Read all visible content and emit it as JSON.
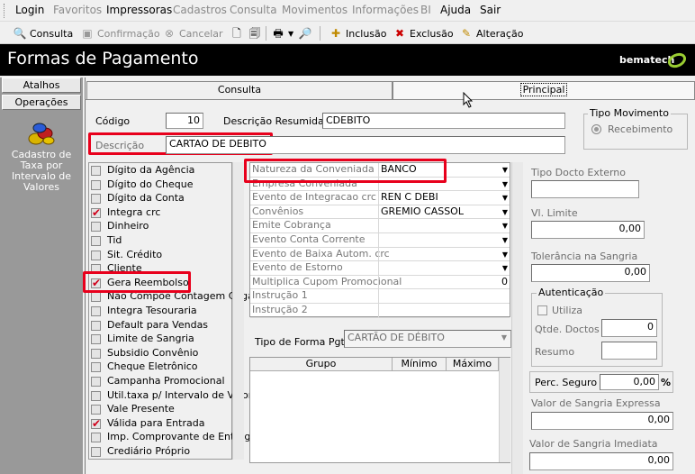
{
  "menu": {
    "items": [
      {
        "label": "Login",
        "enabled": true
      },
      {
        "label": "Favoritos",
        "enabled": false
      },
      {
        "label": "Impressoras",
        "enabled": true
      },
      {
        "label": "Cadastros",
        "enabled": false
      },
      {
        "label": "Consulta",
        "enabled": false
      },
      {
        "label": "Movimentos",
        "enabled": false
      },
      {
        "label": "Informações",
        "enabled": false
      },
      {
        "label": "BI",
        "enabled": false
      },
      {
        "label": "Ajuda",
        "enabled": true
      },
      {
        "label": "Sair",
        "enabled": true
      }
    ]
  },
  "toolbar": {
    "consulta": "Consulta",
    "confirmacao": "Confirmação",
    "cancelar": "Cancelar",
    "inclusao": "Inclusão",
    "exclusao": "Exclusão",
    "alteracao": "Alteração"
  },
  "window": {
    "title": "Formas de Pagamento",
    "brand": "bematech"
  },
  "sidebar": {
    "atalhos": "Atalhos",
    "operacoes": "Operações",
    "item_label": "Cadastro de Taxa por Intervalo de Valores"
  },
  "tabs": {
    "consulta": "Consulta",
    "principal": "Principal"
  },
  "form": {
    "codigo_label": "Código",
    "codigo_value": "10",
    "desc_resumida_label": "Descrição Resumida",
    "desc_resumida_value": "CDEBITO",
    "descricao_label": "Descrição",
    "descricao_value": "CARTAO DE DEBITO",
    "tipo_movimento_label": "Tipo Movimento",
    "recebimento_label": "Recebimento"
  },
  "checklist": [
    {
      "label": "Dígito da Agência",
      "checked": false
    },
    {
      "label": "Dígito do Cheque",
      "checked": false
    },
    {
      "label": "Dígito da Conta",
      "checked": false
    },
    {
      "label": "Integra crc",
      "checked": true
    },
    {
      "label": "Dinheiro",
      "checked": false
    },
    {
      "label": "Tid",
      "checked": false
    },
    {
      "label": "Sit. Crédito",
      "checked": false
    },
    {
      "label": "Cliente",
      "checked": false
    },
    {
      "label": "Gera Reembolso",
      "checked": true
    },
    {
      "label": "Não Compõe Contagem Cega",
      "checked": false
    },
    {
      "label": "Integra Tesouraria",
      "checked": false
    },
    {
      "label": "Default para Vendas",
      "checked": false
    },
    {
      "label": "Limite de Sangria",
      "checked": false
    },
    {
      "label": "Subsidio Convênio",
      "checked": false
    },
    {
      "label": "Cheque Eletrônico",
      "checked": false
    },
    {
      "label": "Campanha Promocional",
      "checked": false
    },
    {
      "label": "Util.taxa p/ Intervalo de Valor.",
      "checked": false
    },
    {
      "label": "Vale Presente",
      "checked": false
    },
    {
      "label": "Válida para Entrada",
      "checked": true
    },
    {
      "label": "Imp. Comprovante de Entrega",
      "checked": false
    },
    {
      "label": "Crediário Próprio",
      "checked": false
    }
  ],
  "props": [
    {
      "key": "Natureza da Conveniada",
      "value": "BANCO",
      "dropdown": true
    },
    {
      "key": "Empresa Conveniada",
      "value": "",
      "dropdown": true
    },
    {
      "key": "Evento de Integracao crc",
      "value": "REN C DEBI",
      "dropdown": true
    },
    {
      "key": "Convênios",
      "value": "GREMIO CASSOL",
      "dropdown": true
    },
    {
      "key": "Emite Cobrança",
      "value": "",
      "dropdown": true
    },
    {
      "key": "Evento Conta Corrente",
      "value": "",
      "dropdown": true
    },
    {
      "key": "Evento de Baixa Autom. crc",
      "value": "",
      "dropdown": true
    },
    {
      "key": "Evento de Estorno",
      "value": "",
      "dropdown": true
    },
    {
      "key": "Multiplica Cupom Promocional",
      "value": "0",
      "dropdown": false
    },
    {
      "key": "Instrução 1",
      "value": "",
      "dropdown": false
    },
    {
      "key": "Instrução 2",
      "value": "",
      "dropdown": false
    }
  ],
  "tipo_forma": {
    "label": "Tipo de Forma Pgto",
    "value": "CARTÃO DE DÉBITO"
  },
  "table": {
    "headers": [
      "Grupo",
      "Mínimo",
      "Máximo"
    ]
  },
  "right": {
    "tipo_docto_label": "Tipo Docto Externo",
    "tipo_docto_value": "",
    "vl_limite_label": "Vl. Limite",
    "vl_limite_value": "0,00",
    "tolerancia_label": "Tolerância na Sangria",
    "tolerancia_value": "0,00",
    "autenticacao_label": "Autenticação",
    "utiliza_label": "Utiliza",
    "qtde_label": "Qtde. Doctos",
    "qtde_value": "0",
    "resumo_label": "Resumo",
    "resumo_value": "",
    "perc_label": "Perc. Seguro",
    "perc_value": "0,00",
    "perc_unit": "%",
    "sangria_exp_label": "Valor de Sangria Expressa",
    "sangria_exp_value": "0,00",
    "sangria_imed_label": "Valor de Sangria Imediata",
    "sangria_imed_value": "0,00"
  }
}
